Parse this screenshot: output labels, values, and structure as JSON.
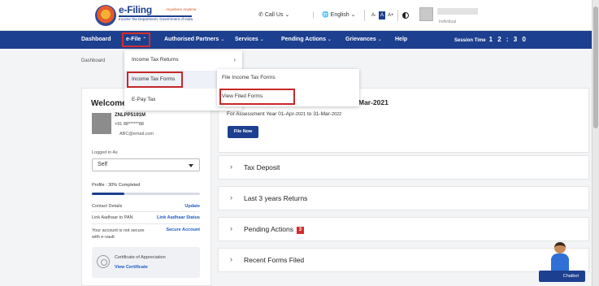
{
  "header": {
    "logo_title": "e-Filing",
    "logo_tagline": "Anywhere Anytime",
    "logo_subtitle": "Income Tax Department, Government of India",
    "call_us": "Call Us",
    "language": "English",
    "font_small": "A-",
    "font_normal": "A",
    "font_large": "A+",
    "user_role": "Individual"
  },
  "nav": {
    "items": [
      "Dashboard",
      "e-File",
      "Authorised Partners",
      "Services",
      "Pending Actions",
      "Grievances",
      "Help"
    ],
    "session_label": "Session Time",
    "session_value": "1 2 : 3 0"
  },
  "breadcrumb": "Dashboard",
  "efile_menu": {
    "items": [
      "Income Tax Returns",
      "Income Tax Forms",
      "E-Pay Tax"
    ],
    "highlighted": "Income Tax Forms"
  },
  "forms_submenu": {
    "items": [
      "File Income Tax Forms",
      "View Filed Forms"
    ],
    "highlighted": "View Filed Forms"
  },
  "profile": {
    "welcome": "Welcome I",
    "pan": "ZNLPP5191M",
    "phone": "+91 88******88",
    "email": "ABC@email.com",
    "logged_in_as_label": "Logged in As",
    "logged_in_as_value": "Self",
    "profile_completed": "Profile : 30% Completed",
    "profile_pct": 0.3,
    "contact_details_label": "Contact Details",
    "contact_details_link": "Update",
    "aadhaar_label": "Link Aadhaar to PAN",
    "aadhaar_link": "Link Aadhaar Status",
    "evault_label": "Your account is not secure with e-vault",
    "evault_link": "Secure Account",
    "certificate_title": "Certificate of Appreciation",
    "certificate_link": "View Certificate"
  },
  "return_card": {
    "title_tail": "Mar-2021",
    "sub_prefix": "For Assessment Year 01-Apr-",
    "sub_y1": "2021",
    "sub_mid": " to 31-Mar-",
    "sub_y2": "2022",
    "file_now": "File Now"
  },
  "accordions": [
    {
      "label": "Tax Deposit"
    },
    {
      "label": "Last 3 years Returns"
    },
    {
      "label": "Pending Actions",
      "badge": "3"
    },
    {
      "label": "Recent Forms Filed"
    }
  ],
  "chatbot_label": "Chatbot",
  "colors": {
    "primary": "#1d3f8f",
    "highlight_border": "#c62828",
    "badge": "#d32f2f",
    "link": "#1d5cc7"
  }
}
